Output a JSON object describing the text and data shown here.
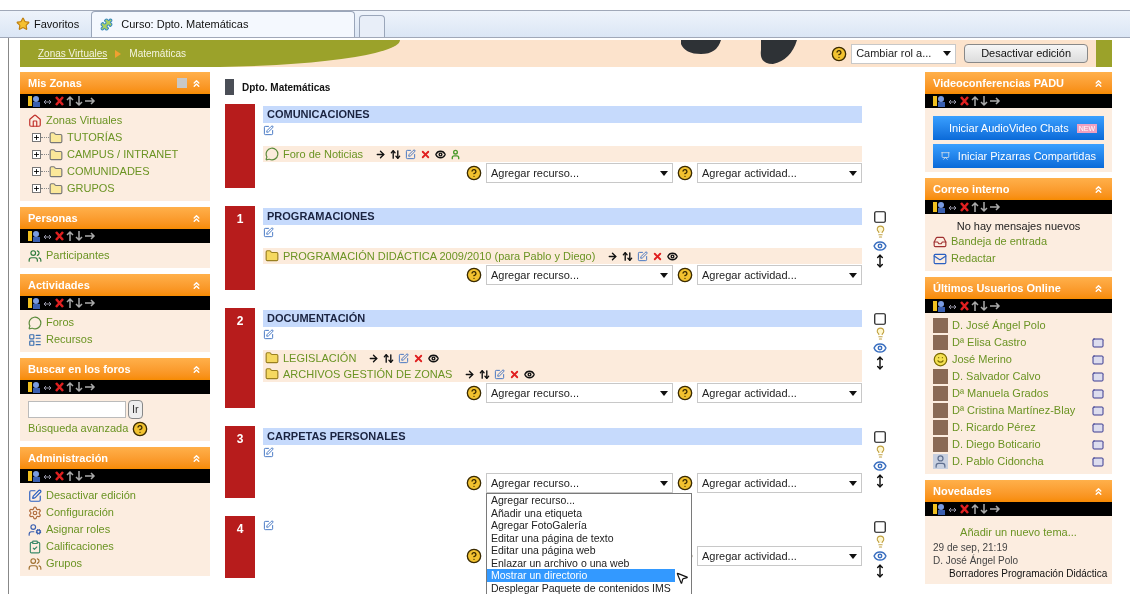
{
  "browser": {
    "favorites": "Favoritos",
    "tabs": [
      {
        "label": "Curso: Dpto. Matemáticas",
        "selected": true
      }
    ]
  },
  "header": {
    "breadcrumb": [
      {
        "label": "Zonas Virtuales",
        "link": true
      },
      {
        "label": "Matemáticas",
        "link": false
      }
    ],
    "role_select": "Cambiar rol a...",
    "edit_button": "Desactivar edición"
  },
  "left_blocks": [
    {
      "title": "Mis Zonas",
      "docked": true,
      "items": [
        {
          "kind": "home",
          "label": "Zonas Virtuales"
        },
        {
          "kind": "folder",
          "label": "TUTORÍAS",
          "expanded": false
        },
        {
          "kind": "folder",
          "label": "CAMPUS / INTRANET",
          "expanded": false
        },
        {
          "kind": "folder",
          "label": "COMUNIDADES",
          "expanded": false
        },
        {
          "kind": "folder",
          "label": "GRUPOS",
          "expanded": false
        }
      ]
    },
    {
      "title": "Personas",
      "items": [
        {
          "kind": "people",
          "label": "Participantes"
        }
      ]
    },
    {
      "title": "Actividades",
      "items": [
        {
          "kind": "forum",
          "label": "Foros"
        },
        {
          "kind": "resource",
          "label": "Recursos"
        }
      ]
    },
    {
      "title": "Buscar en los foros",
      "items": [
        {
          "kind": "search",
          "button": "Ir"
        },
        {
          "kind": "help_link",
          "label": "Búsqueda avanzada"
        }
      ]
    },
    {
      "title": "Administración",
      "items": [
        {
          "kind": "edit",
          "label": "Desactivar edición"
        },
        {
          "kind": "settings",
          "label": "Configuración"
        },
        {
          "kind": "roles",
          "label": "Asignar roles"
        },
        {
          "kind": "grades",
          "label": "Calificaciones"
        },
        {
          "kind": "groups",
          "label": "Grupos"
        }
      ]
    }
  ],
  "course": {
    "title": "Dpto. Matemáticas",
    "sections": [
      {
        "title": "COMUNICACIONES",
        "activities": [
          {
            "kind": "forum",
            "label": "Foro de Noticias"
          }
        ],
        "resource_select": "Agregar recurso...",
        "activity_select": "Agregar actividad...",
        "side_controls": false
      },
      {
        "number": "1",
        "title": "PROGRAMACIONES",
        "activities": [
          {
            "kind": "folder",
            "label": "PROGRAMACIÓN DIDÁCTICA 2009/2010 (para Pablo y Diego)"
          }
        ],
        "resource_select": "Agregar recurso...",
        "activity_select": "Agregar actividad...",
        "side_controls": true
      },
      {
        "number": "2",
        "title": "DOCUMENTACIÓN",
        "activities": [
          {
            "kind": "folder",
            "label": "LEGISLACIÓN"
          },
          {
            "kind": "folder",
            "label": "ARCHIVOS GESTIÓN DE ZONAS"
          }
        ],
        "resource_select": "Agregar recurso...",
        "activity_select": "Agregar actividad...",
        "side_controls": true
      },
      {
        "number": "3",
        "title": "CARPETAS PERSONALES",
        "resource_select": "Agregar recurso...",
        "resource_menu": [
          {
            "label": "Agregar recurso...",
            "selected": false
          },
          {
            "label": "Añadir una etiqueta",
            "selected": false
          },
          {
            "label": "Agregar FotoGalería",
            "selected": false
          },
          {
            "label": "Editar una página de texto",
            "selected": false
          },
          {
            "label": "Editar una página web",
            "selected": false
          },
          {
            "label": "Enlazar un archivo o una web",
            "selected": false
          },
          {
            "label": "Mostrar un directorio",
            "selected": true
          },
          {
            "label": "Desplegar Paquete de contenidos IMS",
            "selected": false
          }
        ],
        "activity_select": "Agregar actividad...",
        "side_controls": true
      },
      {
        "number": "4",
        "activity_select": "Agregar actividad...",
        "side_controls": true
      }
    ]
  },
  "right_blocks": [
    {
      "title": "Videoconferencias PADU",
      "items": [
        {
          "kind": "video_button",
          "label": "Iniciar AudioVideo Chats",
          "badge": "NEW"
        },
        {
          "kind": "board_button",
          "label": "Iniciar Pizarras Compartidas"
        }
      ]
    },
    {
      "title": "Correo interno",
      "items": [
        {
          "kind": "notice",
          "label": "No hay mensajes nuevos"
        },
        {
          "kind": "inbox",
          "label": "Bandeja de entrada"
        },
        {
          "kind": "compose",
          "label": "Redactar"
        }
      ]
    },
    {
      "title": "Últimos Usuarios Online",
      "items": [
        {
          "kind": "user",
          "label": "D. José Ángel Polo",
          "avatar": {
            "kind": "photo"
          },
          "message": false
        },
        {
          "kind": "user",
          "label": "Dª Elisa Castro",
          "avatar": {
            "kind": "photo"
          },
          "message": true
        },
        {
          "kind": "user",
          "label": "José Merino",
          "avatar": {
            "kind": "smiley"
          },
          "message": true
        },
        {
          "kind": "user",
          "label": "D. Salvador Calvo",
          "avatar": {
            "kind": "photo"
          },
          "message": true
        },
        {
          "kind": "user",
          "label": "Dª Manuela Grados",
          "avatar": {
            "kind": "photo"
          },
          "message": true
        },
        {
          "kind": "user",
          "label": "Dª Cristina Martínez-Blay",
          "avatar": {
            "kind": "photo"
          },
          "message": true
        },
        {
          "kind": "user",
          "label": "D. Ricardo Pérez",
          "avatar": {
            "kind": "photo"
          },
          "message": true
        },
        {
          "kind": "user",
          "label": "D. Diego Boticario",
          "avatar": {
            "kind": "photo"
          },
          "message": true
        },
        {
          "kind": "user",
          "label": "D. Pablo Cidoncha",
          "avatar": {
            "kind": "silhouette"
          },
          "message": true
        }
      ]
    },
    {
      "title": "Novedades",
      "items": [
        {
          "kind": "add_link",
          "label": "Añadir un nuevo tema..."
        },
        {
          "kind": "post_date",
          "label": "29 de sep, 21:19"
        },
        {
          "kind": "post_author",
          "label": "D. José Ángel Polo"
        },
        {
          "kind": "post_title",
          "label": "Borradores Programación Didáctica"
        }
      ]
    }
  ]
}
